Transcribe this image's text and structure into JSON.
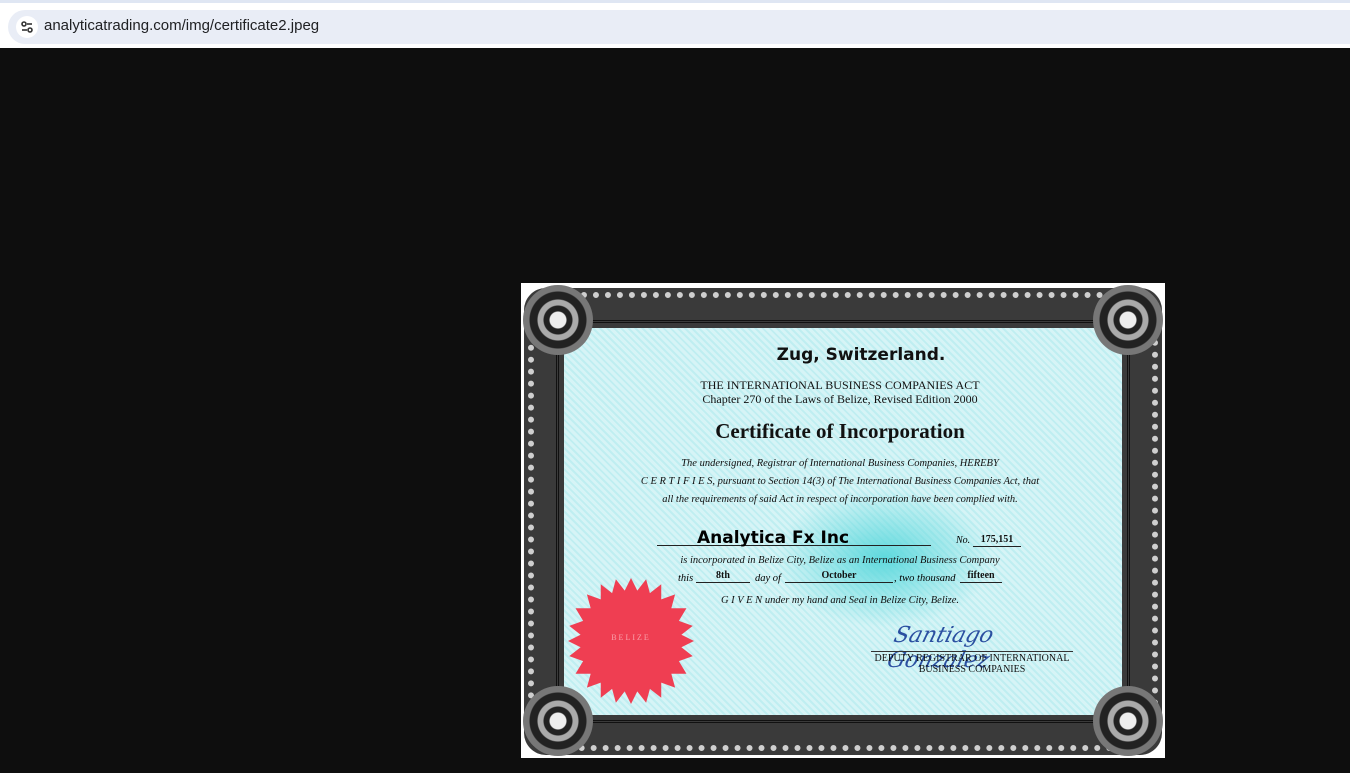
{
  "browser": {
    "url": "analyticatrading.com/img/certificate2.jpeg",
    "site_info_icon": "tune-icon"
  },
  "certificate": {
    "location": "Zug, Switzerland.",
    "act_title": "THE INTERNATIONAL BUSINESS COMPANIES ACT",
    "act_chapter": "Chapter 270 of the Laws of Belize, Revised Edition 2000",
    "title": "Certificate of Incorporation",
    "body_line1": "The undersigned, Registrar of International Business Companies, HEREBY",
    "body_line2": "C E R T I F I E S, pursuant to Section 14(3) of The International Business Companies Act, that",
    "body_line3": "all the requirements of said Act in respect of incorporation have been complied with.",
    "company_name": "Analytica Fx Inc",
    "no_label": "No.",
    "number": "175,151",
    "incorporated_line": "is incorporated in Belize City, Belize as an International Business Company",
    "this_label": "this",
    "day": "8th",
    "day_of_label": "day of",
    "month": "October",
    "two_thousand_label": ", two thousand",
    "year": "fifteen",
    "given_line": "G I V E N under my hand and Seal in Belize City, Belize.",
    "signature": "Santiago Gonzalez",
    "signatory_title1": "DEPUTY REGISTRAR OF INTERNATIONAL",
    "signatory_title2": "BUSINESS COMPANIES",
    "seal_text": "BELIZE"
  }
}
